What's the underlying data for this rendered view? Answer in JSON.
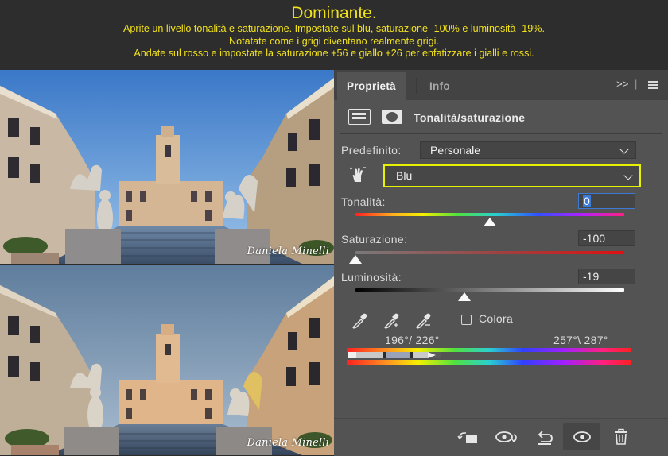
{
  "banner": {
    "title": "Dominante.",
    "lines": [
      "Aprite un livello tonalità e saturazione. Impostate sul blu, saturazione -100% e luminosità -19%.",
      "Notatate come i grigi diventano realmente grigi.",
      "Andate sul rosso e impostate la saturazione +56 e giallo +26 per enfatizzare i gialli e rossi."
    ]
  },
  "photos": {
    "top_signature": "Daniela Minelli",
    "bottom_signature": "Daniela Minelli"
  },
  "panel": {
    "tabs": [
      {
        "label": "Proprietà",
        "active": true
      },
      {
        "label": "Info",
        "active": false
      }
    ],
    "collapse_label": ">>",
    "adjustment_title": "Tonalità/saturazione",
    "preset_label": "Predefinito:",
    "preset_value": "Personale",
    "channel_value": "Blu",
    "hue": {
      "label": "Tonalità:",
      "value": "0",
      "level": 0.5
    },
    "saturation": {
      "label": "Saturazione:",
      "value": "-100",
      "level": 0.0
    },
    "lightness": {
      "label": "Luminosità:",
      "value": "-19",
      "level": 0.405
    },
    "colorize_label": "Colora",
    "colorize_checked": false,
    "range_left": "196°/ 226°",
    "range_right": "257°\\ 287°",
    "colors": {
      "banner_text": "#f2e21c",
      "panel_bg": "#535353",
      "highlight": "#e6f200",
      "focus": "#3d7ad6"
    },
    "icons": [
      "adjustment-layer-icon",
      "mask-icon",
      "targeted-adjust-hand-icon",
      "eyedropper-icon",
      "eyedropper-add-icon",
      "eyedropper-subtract-icon",
      "clip-to-layer-icon",
      "view-previous-state-icon",
      "reset-icon",
      "visibility-eye-icon",
      "trash-icon"
    ]
  }
}
